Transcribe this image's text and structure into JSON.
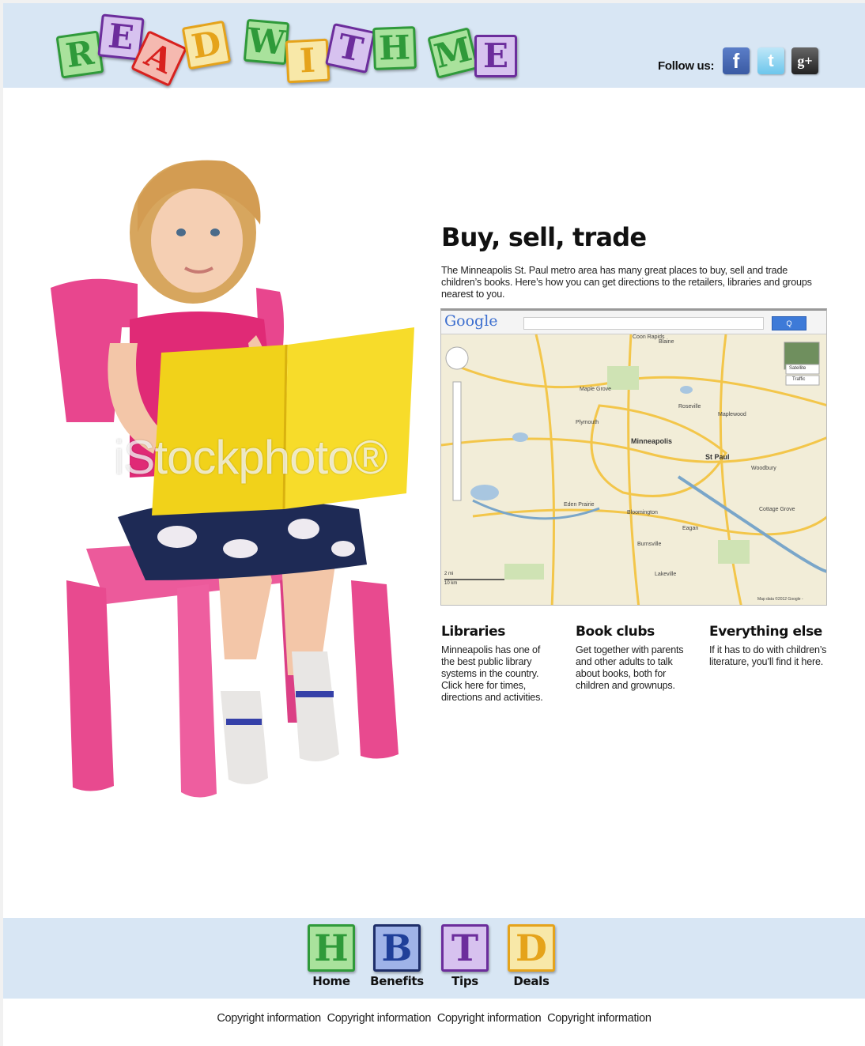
{
  "header": {
    "logo_letters": [
      {
        "letter": "R",
        "color": "#2f9a3a",
        "bg": "#a9e29c"
      },
      {
        "letter": "E",
        "color": "#6c2d9c",
        "bg": "#d7c2ef"
      },
      {
        "letter": "A",
        "color": "#d8211e",
        "bg": "#f5b9b0"
      },
      {
        "letter": "D",
        "color": "#e5a31b",
        "bg": "#f8e8a8"
      },
      {
        "letter": "W",
        "color": "#2f9a3a",
        "bg": "#a9e29c"
      },
      {
        "letter": "I",
        "color": "#e5a31b",
        "bg": "#f8e8a8"
      },
      {
        "letter": "T",
        "color": "#6c2d9c",
        "bg": "#d7c2ef"
      },
      {
        "letter": "H",
        "color": "#2f9a3a",
        "bg": "#a9e29c"
      },
      {
        "letter": "M",
        "color": "#2f9a3a",
        "bg": "#a9e29c"
      },
      {
        "letter": "E",
        "color": "#6c2d9c",
        "bg": "#d7c2ef"
      }
    ],
    "follow_label": "Follow us:",
    "social": [
      {
        "name": "facebook-icon",
        "glyph": "f"
      },
      {
        "name": "twitter-icon",
        "glyph": "t"
      },
      {
        "name": "google-plus-icon",
        "glyph": "g+"
      }
    ]
  },
  "hero": {
    "watermark": "iStockphoto®"
  },
  "main": {
    "title": "Buy, sell, trade",
    "intro": "The Minneapolis St. Paul metro area has many great places to buy, sell and trade children’s books. Here’s how you can get directions to the retailers, libraries and groups nearest to you."
  },
  "map": {
    "logo": "Google",
    "button": "Q",
    "labels": [
      "Minneapolis",
      "St Paul",
      "Woodbury",
      "Maplewood",
      "Roseville",
      "Blaine",
      "Eden Prairie",
      "Bloomington",
      "Burnsville",
      "Eagan",
      "Plymouth",
      "Maple Grove",
      "Coon Rapids",
      "Lakeville",
      "Cottage Grove"
    ],
    "controls": [
      "Satellite",
      "Traffic"
    ],
    "scale": [
      "2 mi",
      "10 km"
    ],
    "copyright": "Map data ©2012 Google -"
  },
  "columns": [
    {
      "title": "Libraries",
      "text": "Minneapolis has one of the best public library systems in the country. Click here for times, directions and activities."
    },
    {
      "title": "Book clubs",
      "text": "Get together with parents and other adults to talk about books, both for children and grownups."
    },
    {
      "title": "Everything else",
      "text": "If it has to do with children’s literature, you’ll find it here."
    }
  ],
  "footer_nav": [
    {
      "letter": "H",
      "label": "Home",
      "color": "#2f9a3a",
      "bg": "#a9e29c",
      "border": "#2f9a3a"
    },
    {
      "letter": "B",
      "label": "Benefits",
      "color": "#1f3f99",
      "bg": "#9fb3e8",
      "border": "#1f2f6a"
    },
    {
      "letter": "T",
      "label": "Tips",
      "color": "#6c2d9c",
      "bg": "#d7c2ef",
      "border": "#6c2d9c"
    },
    {
      "letter": "D",
      "label": "Deals",
      "color": "#e5a31b",
      "bg": "#f8e8a8",
      "border": "#e5a31b"
    }
  ],
  "copyright": [
    "Copyright information",
    "Copyright information",
    "Copyright information",
    "Copyright information"
  ]
}
